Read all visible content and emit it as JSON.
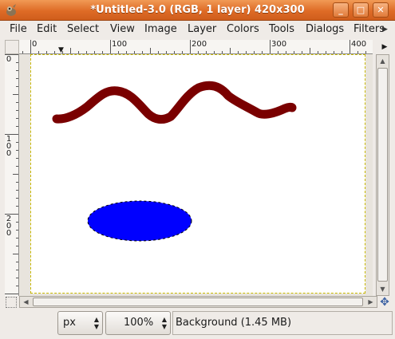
{
  "window": {
    "title": "*Untitled-3.0 (RGB, 1 layer) 420x300",
    "app_icon": "gimp-wilber-icon",
    "minimize_label": "_",
    "maximize_label": "□",
    "close_label": "✕"
  },
  "menu": {
    "items": [
      {
        "label": "File",
        "mnemonic": "F"
      },
      {
        "label": "Edit",
        "mnemonic": "E"
      },
      {
        "label": "Select",
        "mnemonic": "S"
      },
      {
        "label": "View",
        "mnemonic": "V"
      },
      {
        "label": "Image",
        "mnemonic": "I"
      },
      {
        "label": "Layer",
        "mnemonic": "L"
      },
      {
        "label": "Colors",
        "mnemonic": "C"
      },
      {
        "label": "Tools",
        "mnemonic": "T"
      },
      {
        "label": "Dialogs",
        "mnemonic": "D"
      },
      {
        "label": "Filters",
        "mnemonic": "r"
      }
    ],
    "overflow_icon": "triangle-right-icon"
  },
  "rulers": {
    "horizontal_labels": [
      "0",
      "100",
      "200",
      "300",
      "400"
    ],
    "vertical_labels": [
      "0",
      "100",
      "200"
    ],
    "pointer_marker_icon": "triangle-down-icon"
  },
  "canvas": {
    "image_size": "420x300",
    "background": "#ffffff",
    "stroke_color": "#7a0000",
    "ellipse_color": "#0000ff",
    "selection": "marching-ants around ellipse"
  },
  "statusbar": {
    "unit": "px",
    "zoom": "100%",
    "layer_info": "Background (1.45 MB)"
  }
}
